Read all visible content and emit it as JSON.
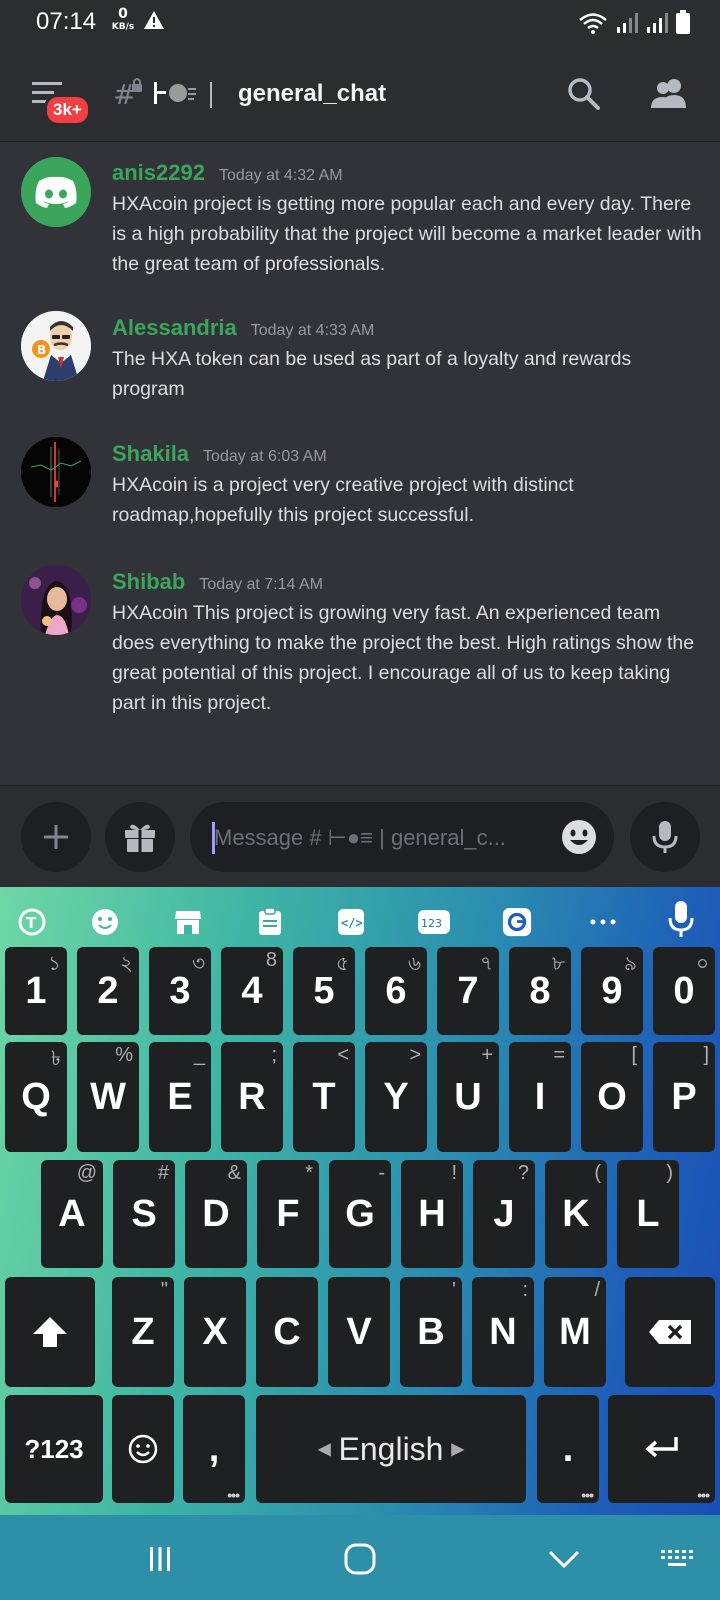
{
  "status": {
    "time": "07:14",
    "net_speed": "0",
    "net_unit": "KB/s"
  },
  "header": {
    "unread_badge": "3k+",
    "channel_name": "general_chat"
  },
  "messages": [
    {
      "author": "anis2292",
      "timestamp": "Today at 4:32 AM",
      "text": "HXAcoin project is getting more popular each and every day. There is a high probability that the project will become a market leader with the great team of professionals."
    },
    {
      "author": "Alessandria",
      "timestamp": "Today at 4:33 AM",
      "text": "The HXA token can be used as part of a loyalty and rewards program"
    },
    {
      "author": "Shakila",
      "timestamp": "Today at 6:03 AM",
      "text": "HXAcoin is a project very creative project with distinct roadmap,hopefully this project successful."
    },
    {
      "author": "Shibab",
      "timestamp": "Today at 7:14 AM",
      "text": "HXAcoin This project is growing very fast. An experienced team does everything to make the project the best. High ratings show the great potential of this project. I encourage all of us to keep taking part in this project."
    }
  ],
  "composer": {
    "placeholder": "Message # ⊢●≡ | general_c..."
  },
  "keyboard": {
    "toolbar_123": "123",
    "number_row": [
      {
        "main": "1",
        "sub": "১"
      },
      {
        "main": "2",
        "sub": "২"
      },
      {
        "main": "3",
        "sub": "৩"
      },
      {
        "main": "4",
        "sub": "8"
      },
      {
        "main": "5",
        "sub": "৫"
      },
      {
        "main": "6",
        "sub": "৬"
      },
      {
        "main": "7",
        "sub": "৭"
      },
      {
        "main": "8",
        "sub": "৮"
      },
      {
        "main": "9",
        "sub": "৯"
      },
      {
        "main": "0",
        "sub": "০"
      }
    ],
    "row_q": [
      {
        "main": "Q",
        "sub": "৳"
      },
      {
        "main": "W",
        "sub": "%"
      },
      {
        "main": "E",
        "sub": "_"
      },
      {
        "main": "R",
        "sub": ";"
      },
      {
        "main": "T",
        "sub": "<"
      },
      {
        "main": "Y",
        "sub": ">"
      },
      {
        "main": "U",
        "sub": "+"
      },
      {
        "main": "I",
        "sub": "="
      },
      {
        "main": "O",
        "sub": "["
      },
      {
        "main": "P",
        "sub": "]"
      }
    ],
    "row_a": [
      {
        "main": "A",
        "sub": "@"
      },
      {
        "main": "S",
        "sub": "#"
      },
      {
        "main": "D",
        "sub": "&"
      },
      {
        "main": "F",
        "sub": "*"
      },
      {
        "main": "G",
        "sub": "-"
      },
      {
        "main": "H",
        "sub": "!"
      },
      {
        "main": "J",
        "sub": "?"
      },
      {
        "main": "K",
        "sub": "("
      },
      {
        "main": "L",
        "sub": ")"
      }
    ],
    "row_z": [
      {
        "main": "Z",
        "sub": "\""
      },
      {
        "main": "X",
        "sub": ""
      },
      {
        "main": "C",
        "sub": ""
      },
      {
        "main": "V",
        "sub": ""
      },
      {
        "main": "B",
        "sub": "'"
      },
      {
        "main": "N",
        "sub": ":"
      },
      {
        "main": "M",
        "sub": "/"
      }
    ],
    "symbols_label": "?123",
    "comma": ",",
    "space_label": "English",
    "period": "."
  },
  "colors": {
    "author": "#3ba55c",
    "badge": "#f23f43",
    "key_bg": "#1f2022",
    "nav_bg": "#2e8fa9"
  }
}
